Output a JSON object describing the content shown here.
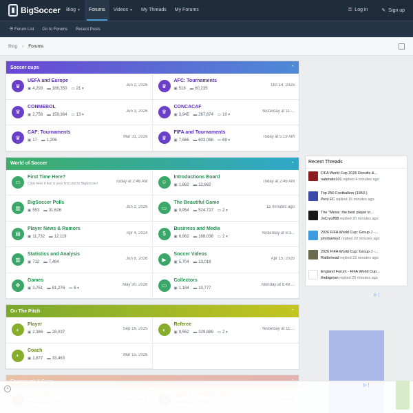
{
  "header": {
    "brand": "BigSoccer",
    "nav": [
      {
        "label": "Blog",
        "caret": true,
        "active": false
      },
      {
        "label": "Forums",
        "caret": false,
        "active": true
      },
      {
        "label": "Videos",
        "caret": true,
        "active": false
      },
      {
        "label": "My Threads",
        "caret": false,
        "active": false
      },
      {
        "label": "My Forums",
        "caret": false,
        "active": false
      }
    ],
    "login": "Log in",
    "signup": "Sign up"
  },
  "subnav": [
    "Forum List",
    "Go to Forums",
    "Recent Posts"
  ],
  "breadcrumb": {
    "home": "Blog",
    "current": "Forums"
  },
  "sections": [
    {
      "title": "Soccer cups",
      "gradient": [
        "#6b47d4",
        "#4e8ad6"
      ],
      "icon_color": "#6a3fc8",
      "title_color": "#5b2fb8",
      "nodes": [
        {
          "icon": "trophy",
          "title": "UEFA and Europe",
          "threads": "4,293",
          "posts": "186,350",
          "sub": "21",
          "last": "Jun 2, 2026"
        },
        {
          "icon": "trophy",
          "title": "AFC: Tournaments",
          "threads": "518",
          "posts": "60,235",
          "sub": "",
          "last": "Oct 14, 2025"
        },
        {
          "icon": "trophy",
          "title": "CONMEBOL",
          "threads": "2,756",
          "posts": "158,364",
          "sub": "13",
          "last": "Jun 3, 2026"
        },
        {
          "icon": "trophy",
          "title": "CONCACAF",
          "threads": "3,945",
          "posts": "267,874",
          "sub": "10",
          "last": "Yesterday at 11:..."
        },
        {
          "icon": "trophy",
          "title": "CAF: Tournaments",
          "threads": "17",
          "posts": "1,206",
          "sub": "",
          "last": "Mar 31, 2026"
        },
        {
          "icon": "trophy",
          "title": "FIFA and Tournaments",
          "threads": "7,565",
          "posts": "603,088",
          "sub": "69",
          "last": "Today at 5:19 AM"
        }
      ]
    },
    {
      "title": "World of Soccer",
      "gradient": [
        "#3fae6a",
        "#2fa8c8"
      ],
      "icon_color": "#3aa768",
      "title_color": "#2b8c52",
      "nodes": [
        {
          "icon": "folder",
          "title": "First Time Here?",
          "desc": "Click here if this is your first visit to BigSoccer!",
          "last": "Today at 2:46 AM"
        },
        {
          "icon": "users",
          "title": "Introductions Board",
          "threads": "1,862",
          "posts": "12,662",
          "sub": "",
          "last": "Today at 2:46 AM"
        },
        {
          "icon": "chart",
          "title": "BigSoccer Polls",
          "threads": "553",
          "posts": "31,626",
          "sub": "",
          "last": "Jun 2, 2026"
        },
        {
          "icon": "folder",
          "title": "The Beautiful Game",
          "threads": "9,954",
          "posts": "524,727",
          "sub": "2",
          "last": "15 minutes ago"
        },
        {
          "icon": "news",
          "title": "Player News & Rumors",
          "threads": "11,732",
          "posts": "12,119",
          "sub": "",
          "last": "Apr 4, 2024"
        },
        {
          "icon": "dollar",
          "title": "Business and Media",
          "threads": "6,962",
          "posts": "168,038",
          "sub": "2",
          "last": "Yesterday at 6:3..."
        },
        {
          "icon": "chart",
          "title": "Statistics and Analysis",
          "threads": "712",
          "posts": "7,484",
          "sub": "",
          "last": "Jun 8, 2026"
        },
        {
          "icon": "play",
          "title": "Soccer Videos",
          "threads": "5,704",
          "posts": "13,018",
          "sub": "",
          "last": "Apr 15, 2026"
        },
        {
          "icon": "game",
          "title": "Games",
          "threads": "3,751",
          "posts": "81,276",
          "sub": "6",
          "last": "May 30, 2026"
        },
        {
          "icon": "folder",
          "title": "Collectors",
          "threads": "1,184",
          "posts": "10,777",
          "sub": "",
          "last": "Monday at 8:49 ..."
        }
      ]
    },
    {
      "title": "On The Pitch",
      "gradient": [
        "#7aa92e",
        "#c4c51f"
      ],
      "icon_color": "#87ad2d",
      "title_color": "#6b8d1f",
      "nodes": [
        {
          "icon": "whistle",
          "title": "Player",
          "threads": "2,386",
          "posts": "28,037",
          "sub": "",
          "last": "Sep 16, 2025"
        },
        {
          "icon": "whistle",
          "title": "Referee",
          "threads": "9,552",
          "posts": "329,889",
          "sub": "2",
          "last": "Yesterday at 11:..."
        },
        {
          "icon": "whistle",
          "title": "Coach",
          "threads": "1,877",
          "posts": "33,463",
          "sub": "",
          "last": "Mar 15, 2026"
        }
      ]
    },
    {
      "title": "Equipment & Gear",
      "gradient": [
        "#e8701e",
        "#d24a3a"
      ],
      "icon_color": "#e0762b",
      "title_color": "#d0641e",
      "nodes": [
        {
          "icon": "shoe",
          "title": "Soccer Boots",
          "threads": "4,563",
          "posts": "213,356",
          "sub": "",
          "last": "Mar 10, 2026"
        },
        {
          "icon": "shirt",
          "title": "Apparel & Training Gear",
          "threads": "484",
          "posts": "12,023",
          "sub": "",
          "last": "Feb 8, 2026"
        }
      ]
    }
  ],
  "recent_threads": {
    "title": "Recent Threads",
    "items": [
      {
        "title": "FIFA World Cup 2026 Results &...",
        "user": "natenate101",
        "replied": "replied 4 minutes ago",
        "avatar": "#8a1c1c"
      },
      {
        "title": "Top 250 Footballers (1950-)",
        "user": "Perú FC",
        "replied": "replied 15 minutes ago",
        "avatar": "#3a4aa8"
      },
      {
        "title": "The \"Messi: the best player in...",
        "user": "JoCryuff98",
        "replied": "replied 20 minutes ago",
        "avatar": "#1a1a1a"
      },
      {
        "title": "2026 FIFA World Cup: Group J -...",
        "user": "johnbarley2",
        "replied": "replied 22 minutes ago",
        "avatar": "#3d9be0"
      },
      {
        "title": "2026 FIFA World Cup: Group J -...",
        "user": "Rattlehead",
        "replied": "replied 23 minutes ago",
        "avatar": "#6b6b4e"
      },
      {
        "title": "England Forum - FIFA World Cup...",
        "user": "thebigman",
        "replied": "replied 25 minutes ago",
        "avatar": "#ffffff"
      }
    ]
  }
}
